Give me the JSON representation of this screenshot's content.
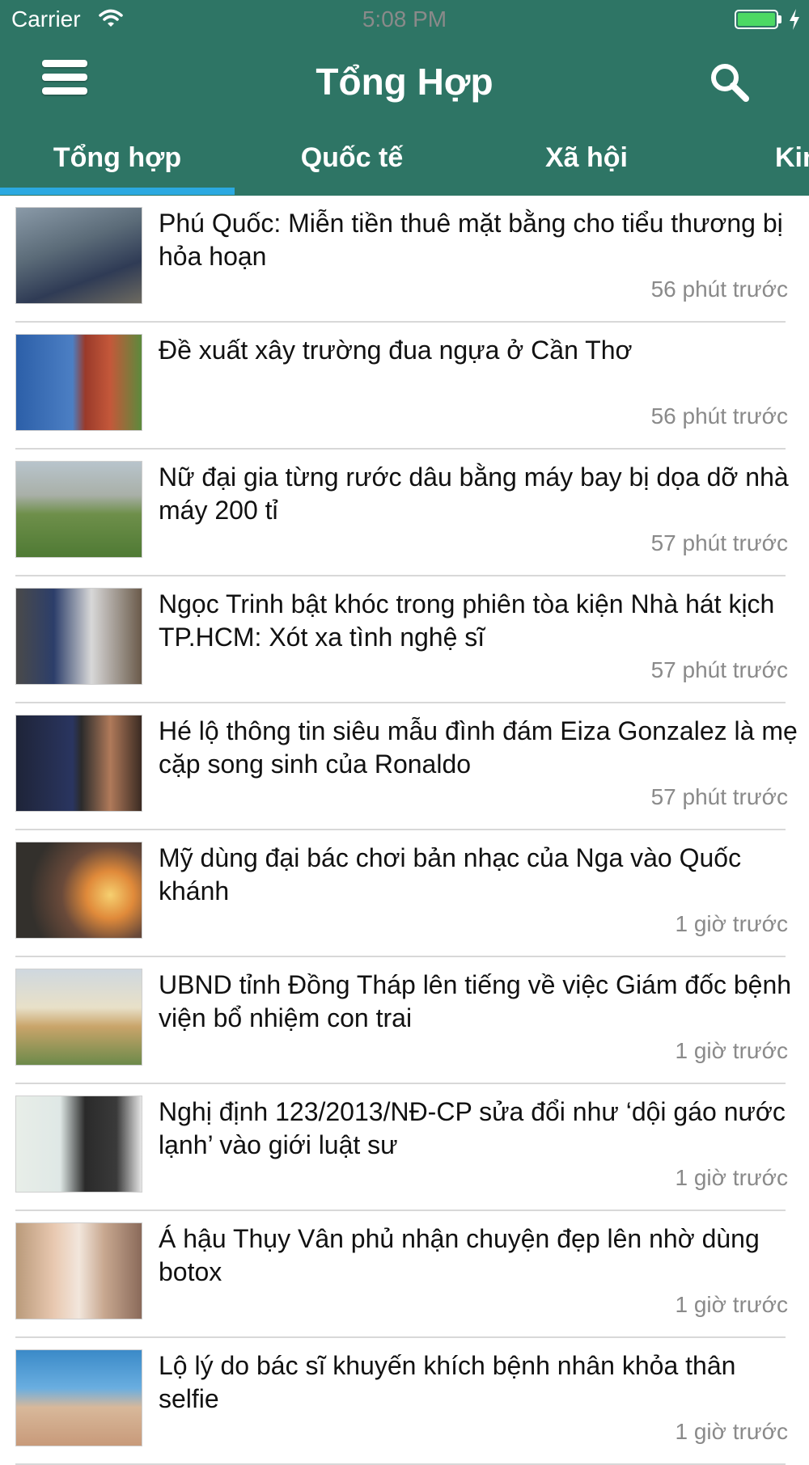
{
  "status_bar": {
    "carrier": "Carrier",
    "time": "5:08 PM"
  },
  "nav": {
    "title": "Tổng Hợp"
  },
  "tabs": [
    {
      "label": "Tổng hợp",
      "active": true
    },
    {
      "label": "Quốc tế",
      "active": false
    },
    {
      "label": "Xã hội",
      "active": false
    },
    {
      "label": "Kin",
      "active": false
    }
  ],
  "colors": {
    "header": "#2e7565",
    "tab_indicator": "#2ba9e1",
    "time_text": "#8a8a8a"
  },
  "articles": [
    {
      "title": "Phú Quốc: Miễn tiền thuê mặt bằng cho tiểu thương bị hỏa hoạn",
      "time": "56 phút trước"
    },
    {
      "title": "Đề xuất xây trường đua ngựa ở Cần Thơ",
      "time": "56 phút trước"
    },
    {
      "title": "Nữ đại gia từng rước dâu bằng máy bay bị dọa dỡ nhà máy 200 tỉ",
      "time": "57 phút trước"
    },
    {
      "title": "Ngọc Trinh bật khóc trong phiên tòa kiện Nhà hát kịch TP.HCM: Xót xa tình nghệ sĩ",
      "time": "57 phút trước"
    },
    {
      "title": "Hé lộ thông tin siêu mẫu đình đám Eiza Gonzalez là mẹ cặp song sinh của Ronaldo",
      "time": "57 phút trước"
    },
    {
      "title": "Mỹ dùng đại bác chơi bản nhạc của Nga vào Quốc khánh",
      "time": "1 giờ trước"
    },
    {
      "title": "UBND tỉnh Đồng Tháp lên tiếng về việc Giám đốc bệnh viện bổ nhiệm con trai",
      "time": "1 giờ trước"
    },
    {
      "title": "Nghị định 123/2013/NĐ-CP sửa đổi như ‘dội gáo nước lạnh’ vào giới luật sư",
      "time": "1 giờ trước"
    },
    {
      "title": "Á hậu Thụy Vân phủ nhận chuyện đẹp lên nhờ dùng botox",
      "time": "1 giờ trước"
    },
    {
      "title": "Lộ lý do bác sĩ khuyến khích bệnh nhân khỏa thân selfie",
      "time": "1 giờ trước"
    }
  ]
}
